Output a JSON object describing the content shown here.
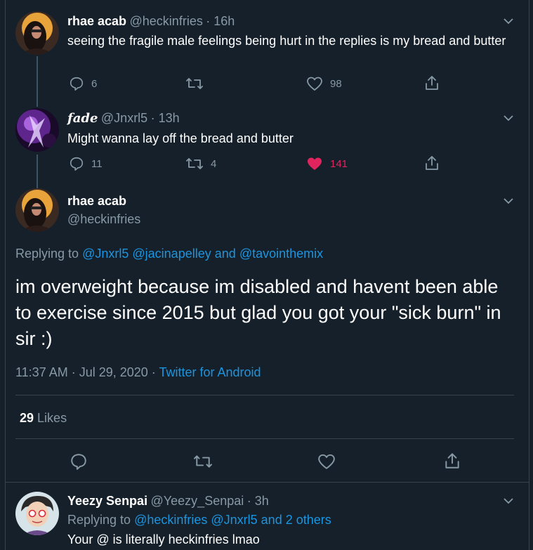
{
  "tweet1": {
    "name": "rhae acab",
    "handle": "@heckinfries",
    "time": "· 16h",
    "text": "seeing the fragile male feelings being hurt in the replies is my bread and butter",
    "replies": "6",
    "likes": "98"
  },
  "tweet2": {
    "name": "fade",
    "handle": "@Jnxrl5",
    "time": "· 13h",
    "text": "Might wanna lay off the bread and butter",
    "replies": "11",
    "retweets": "4",
    "likes": "141"
  },
  "main": {
    "name": "rhae acab",
    "handle": "@heckinfries",
    "replying_prefix": "Replying to",
    "replying_user1": "@Jnxrl5",
    "replying_user2": "@jacinapelley",
    "replying_and": "and",
    "replying_user3": "@tavointhemix",
    "text": "im overweight because im disabled and havent been able to exercise since 2015 but glad you got your \"sick burn\" in sir :)",
    "timestamp": "11:37 AM · Jul 29, 2020 ·",
    "source": "Twitter for Android",
    "likes_count": "29",
    "likes_label": "Likes"
  },
  "reply": {
    "name": "Yeezy Senpai",
    "handle": "@Yeezy_Senpai",
    "time": "· 3h",
    "replying_prefix": "Replying to",
    "replying_users": "@heckinfries @Jnxrl5 and 2 others",
    "text": "Your @ is literally heckinfries lmao"
  },
  "colors": {
    "background": "#15202b",
    "accent": "#1b95e0",
    "like": "#e0245e",
    "muted": "#8899a6"
  }
}
